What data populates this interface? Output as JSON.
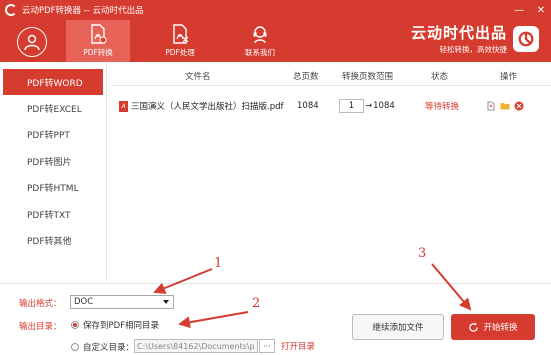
{
  "window": {
    "title": "云动PDF转换器 -- 云动时代出品",
    "controls": [
      "—",
      "✕"
    ]
  },
  "header": {
    "tabs": [
      {
        "label": "PDF转换",
        "icon": "pdf-convert-icon",
        "active": true
      },
      {
        "label": "PDF处理",
        "icon": "pdf-process-icon",
        "active": false
      },
      {
        "label": "联系我们",
        "icon": "support-headset-icon",
        "active": false
      }
    ],
    "brand": {
      "name": "云动时代出品",
      "slogan": "轻松转换，高效快捷"
    }
  },
  "sidebar": {
    "items": [
      {
        "label": "PDF转WORD",
        "active": true
      },
      {
        "label": "PDF转EXCEL"
      },
      {
        "label": "PDF转PPT"
      },
      {
        "label": "PDF转图片"
      },
      {
        "label": "PDF转HTML"
      },
      {
        "label": "PDF转TXT"
      },
      {
        "label": "PDF转其他"
      }
    ]
  },
  "table": {
    "columns": {
      "filename": "文件名",
      "pages": "总页数",
      "range": "转换页数范围",
      "status": "状态",
      "action": "操作"
    },
    "rows": [
      {
        "filename": "三国演义（人民文学出版社）扫描版.pdf",
        "pages": "1084",
        "range_from": "1",
        "range_to": "1084",
        "status": "等待转换"
      }
    ]
  },
  "bottom": {
    "format_label": "输出格式：",
    "format_value": "DOC",
    "dir_label": "输出目录：",
    "option_same": "保存到PDF相同目录",
    "option_custom": "自定义目录：",
    "custom_path": "C:\\Users\\84162\\Documents\\p",
    "browse": "···",
    "open_folder": "打开目录",
    "add_files": "继续添加文件",
    "start": "开始转换"
  },
  "annotations": {
    "n1": "1",
    "n2": "2",
    "n3": "3"
  },
  "colors": {
    "accent": "#d63b2f",
    "tab_active": "#e76357"
  }
}
